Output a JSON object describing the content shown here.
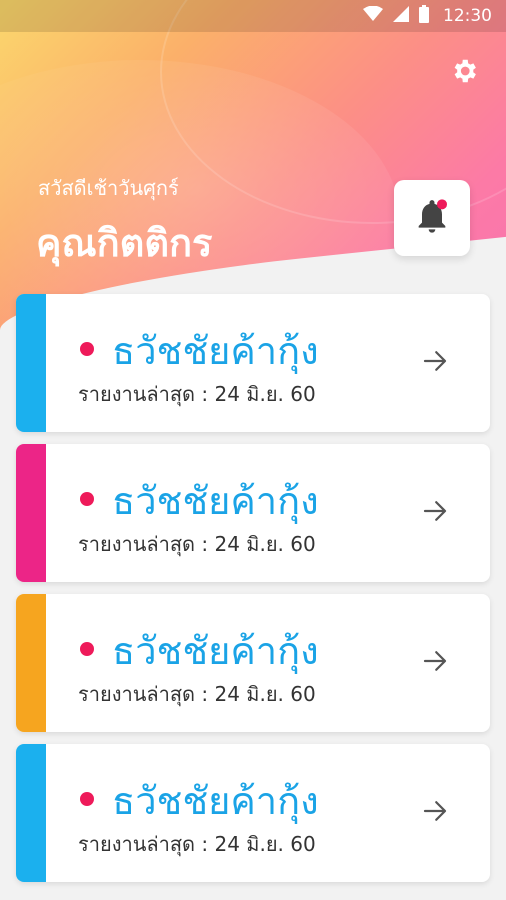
{
  "status": {
    "time": "12:30"
  },
  "header": {
    "greeting": "สวัสดีเช้าวันศุกร์",
    "user_name": "คุณกิตติกร"
  },
  "colors": {
    "title": "#1aa3e6",
    "dot": "#ee1a5a"
  },
  "cards": [
    {
      "title": "ธวัชชัยค้ากุ้ง",
      "subtitle": "รายงานล่าสุด : 24 มิ.ย. 60",
      "stripe_color": "#1bb0ee"
    },
    {
      "title": "ธวัชชัยค้ากุ้ง",
      "subtitle": "รายงานล่าสุด : 24 มิ.ย. 60",
      "stripe_color": "#ec2587"
    },
    {
      "title": "ธวัชชัยค้ากุ้ง",
      "subtitle": "รายงานล่าสุด : 24 มิ.ย. 60",
      "stripe_color": "#f6a51f"
    },
    {
      "title": "ธวัชชัยค้ากุ้ง",
      "subtitle": "รายงานล่าสุด : 24 มิ.ย. 60",
      "stripe_color": "#1bb0ee"
    }
  ]
}
